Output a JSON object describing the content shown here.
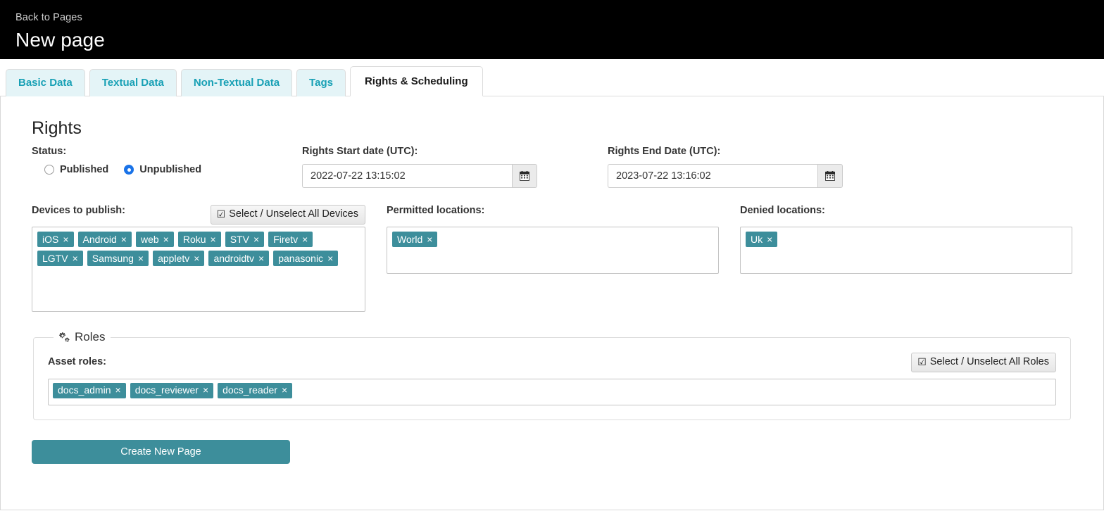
{
  "header": {
    "back_link": "Back to Pages",
    "title": "New page"
  },
  "tabs": [
    {
      "label": "Basic Data",
      "active": false
    },
    {
      "label": "Textual Data",
      "active": false
    },
    {
      "label": "Non-Textual Data",
      "active": false
    },
    {
      "label": "Tags",
      "active": false
    },
    {
      "label": "Rights & Scheduling",
      "active": true
    }
  ],
  "rights": {
    "section_title": "Rights",
    "status_label": "Status:",
    "status_options": [
      {
        "label": "Published",
        "checked": false
      },
      {
        "label": "Unpublished",
        "checked": true
      }
    ],
    "start_date": {
      "label": "Rights Start date (UTC):",
      "value": "2022-07-22 13:15:02",
      "placeholder": "",
      "calendar_icon": "calendar-icon"
    },
    "end_date": {
      "label": "Rights End Date (UTC):",
      "value": "2023-07-22 13:16:02",
      "placeholder": "",
      "calendar_icon": "calendar-icon"
    },
    "devices": {
      "label": "Devices to publish:",
      "select_all_label": "Select / Unselect All Devices",
      "select_all_icon": "checked-box-icon",
      "tags": [
        "iOS",
        "Android",
        "web",
        "Roku",
        "STV",
        "Firetv",
        "LGTV",
        "Samsung",
        "appletv",
        "androidtv",
        "panasonic"
      ]
    },
    "permitted_locations": {
      "label": "Permitted locations:",
      "tags": [
        "World"
      ]
    },
    "denied_locations": {
      "label": "Denied locations:",
      "tags": [
        "Uk"
      ]
    }
  },
  "roles": {
    "legend": "Roles",
    "legend_icon": "gears-icon",
    "asset_roles_label": "Asset roles:",
    "select_all_label": "Select / Unselect All Roles",
    "select_all_icon": "checked-box-icon",
    "tags": [
      "docs_admin",
      "docs_reviewer",
      "docs_reader"
    ]
  },
  "submit": {
    "label": "Create New Page"
  },
  "glyphs": {
    "tag_remove": "×",
    "checked_box": "☑"
  },
  "colors": {
    "accent_teal": "#3d8e9b",
    "tab_link": "#18a0b5",
    "tab_inactive_bg": "#e4f4f7",
    "radio_checked": "#1a73e8",
    "header_bg": "#000000"
  }
}
